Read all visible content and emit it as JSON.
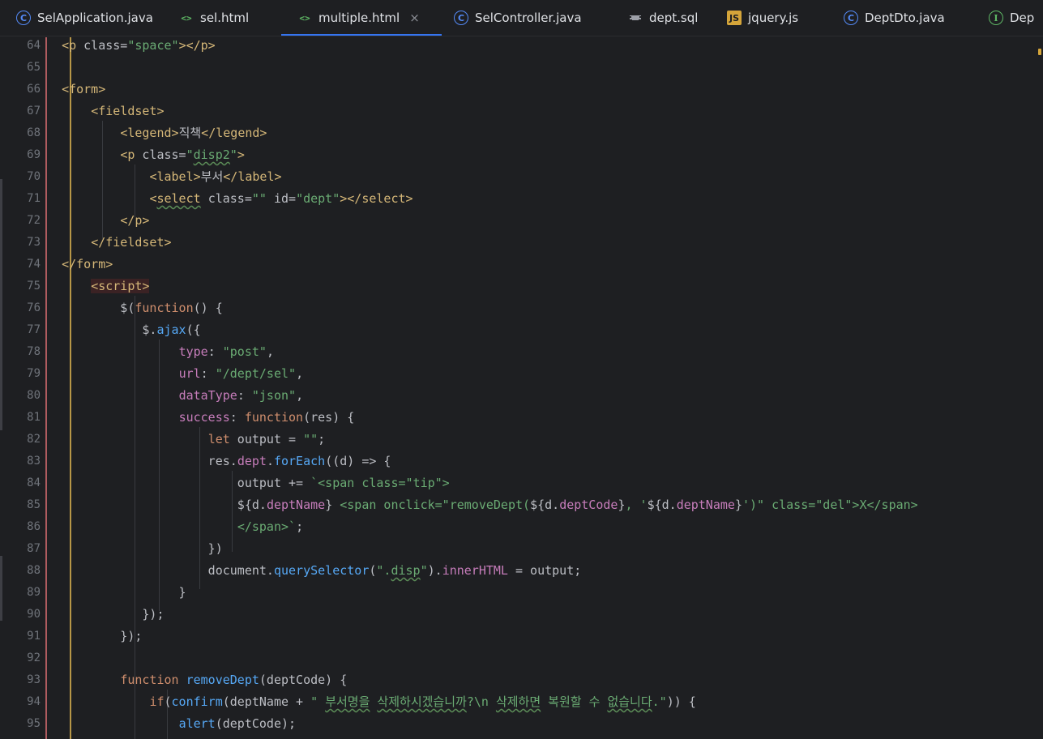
{
  "tabs": [
    {
      "label": "SelApplication.java",
      "icon": "class-icon"
    },
    {
      "label": "sel.html",
      "icon": "html-icon"
    },
    {
      "label": "multiple.html",
      "icon": "html-icon",
      "active": true
    },
    {
      "label": "SelController.java",
      "icon": "class-icon"
    },
    {
      "label": "dept.sql",
      "icon": "sql-icon"
    },
    {
      "label": "jquery.js",
      "icon": "js-icon"
    },
    {
      "label": "DeptDto.java",
      "icon": "class-icon"
    },
    {
      "label": "Dep",
      "icon": "interface-icon"
    }
  ],
  "editor": {
    "line_numbers": [
      "64",
      "65",
      "66",
      "67",
      "68",
      "69",
      "70",
      "71",
      "72",
      "73",
      "74",
      "75",
      "76",
      "77",
      "78",
      "79",
      "80",
      "81",
      "82",
      "83",
      "84",
      "85",
      "86",
      "87",
      "88",
      "89",
      "90",
      "91",
      "92",
      "93",
      "94",
      "95"
    ]
  },
  "colors": {
    "background": "#1e1f22",
    "active_tab_underline": "#3574f0",
    "tag": "#d5b778",
    "string": "#6aab73",
    "keyword": "#cf8e6d",
    "property": "#c77dbb",
    "function": "#56a8f5"
  }
}
